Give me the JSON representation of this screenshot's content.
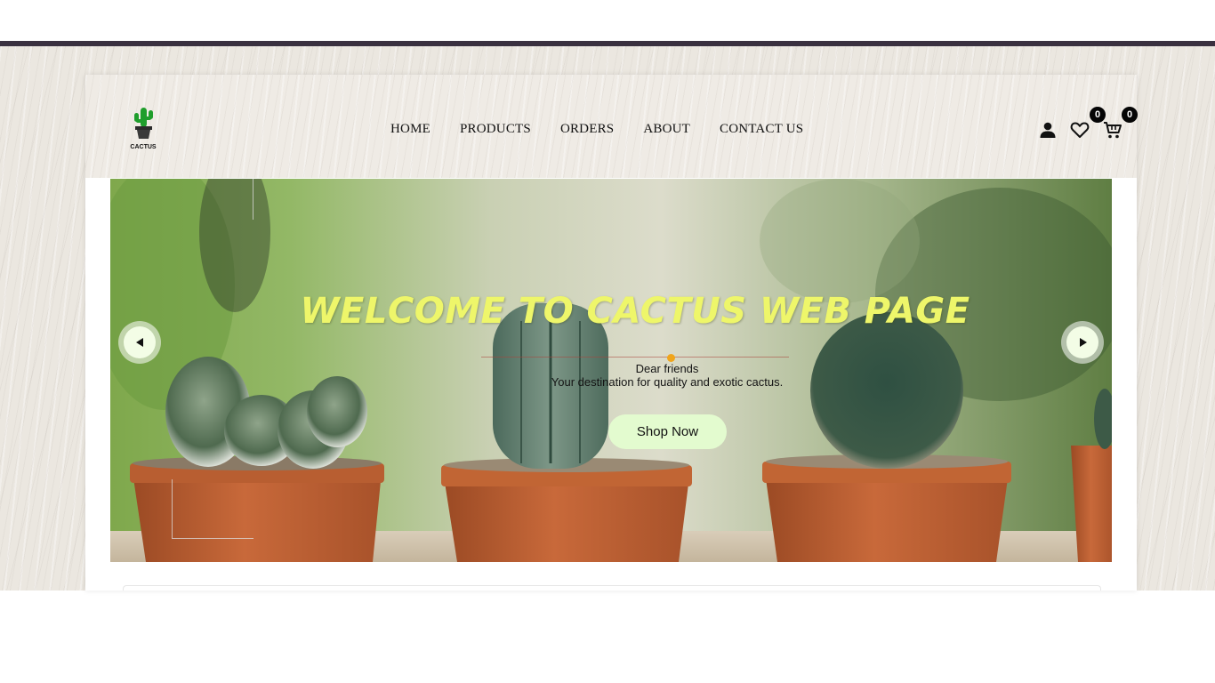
{
  "brand": {
    "logo_text": "CACTUS"
  },
  "nav": {
    "items": [
      {
        "label": "HOME"
      },
      {
        "label": "PRODUCTS"
      },
      {
        "label": "ORDERS"
      },
      {
        "label": "ABOUT"
      },
      {
        "label": "CONTACT US"
      }
    ]
  },
  "header_icons": {
    "user": "user-icon",
    "wishlist": "heart-icon",
    "cart": "cart-icon",
    "wishlist_count": "0",
    "cart_count": "0"
  },
  "hero": {
    "title": "WELCOME TO CACTUS WEB PAGE",
    "greeting": "Dear friends",
    "subtitle": "Your destination for quality and exotic cactus.",
    "cta_label": "Shop Now",
    "prev_icon": "caret-left-icon",
    "next_icon": "caret-right-icon"
  },
  "colors": {
    "top_bar": "#3a3140",
    "title": "#eef66a",
    "cta_bg": "#e3fbcf",
    "badge": "#050505",
    "accent_dot": "#f0a51c"
  }
}
